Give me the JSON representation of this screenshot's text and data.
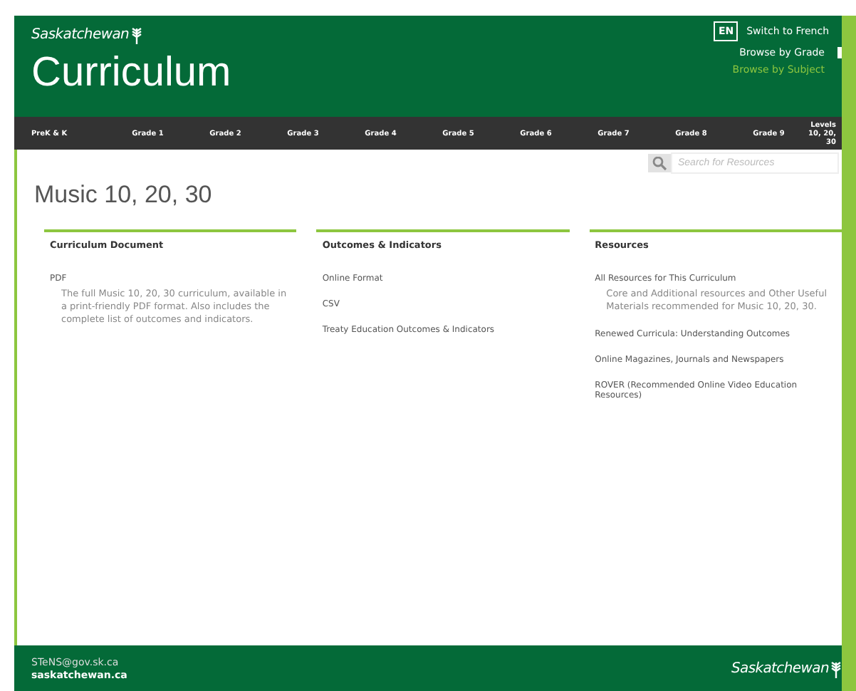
{
  "header": {
    "brand": "Saskatchewan",
    "title": "Curriculum",
    "language_badge": "EN",
    "language_link": "Switch to French",
    "browse_links": [
      {
        "label": "Browse by Grade",
        "selected": true
      },
      {
        "label": "Browse by Subject",
        "selected": false
      }
    ]
  },
  "grade_nav": [
    "PreK & K",
    "Grade 1",
    "Grade 2",
    "Grade 3",
    "Grade 4",
    "Grade 5",
    "Grade 6",
    "Grade 7",
    "Grade 8",
    "Grade 9",
    "Levels 10, 20, 30"
  ],
  "search": {
    "placeholder": "Search for Resources"
  },
  "page_title": "Music 10, 20, 30",
  "columns": [
    {
      "heading": "Curriculum Document",
      "links": [
        {
          "label": "PDF",
          "description": "The full Music 10, 20, 30 curriculum, available in a print-friendly PDF format. Also includes the complete list of outcomes and indicators."
        }
      ]
    },
    {
      "heading": "Outcomes & Indicators",
      "links": [
        {
          "label": "Online Format"
        },
        {
          "label": "CSV"
        },
        {
          "label": "Treaty Education Outcomes & Indicators"
        }
      ]
    },
    {
      "heading": "Resources",
      "links": [
        {
          "label": "All Resources for This Curriculum",
          "description": "Core and Additional resources and Other Useful Materials recommended for Music 10, 20, 30."
        },
        {
          "label": "Renewed Curricula: Understanding Outcomes"
        },
        {
          "label": "Online Magazines, Journals and Newspapers"
        },
        {
          "label": "ROVER (Recommended Online Video Education Resources)"
        }
      ]
    }
  ],
  "footer": {
    "email": "STeNS@gov.sk.ca",
    "website": "saskatchewan.ca",
    "brand": "Saskatchewan"
  }
}
